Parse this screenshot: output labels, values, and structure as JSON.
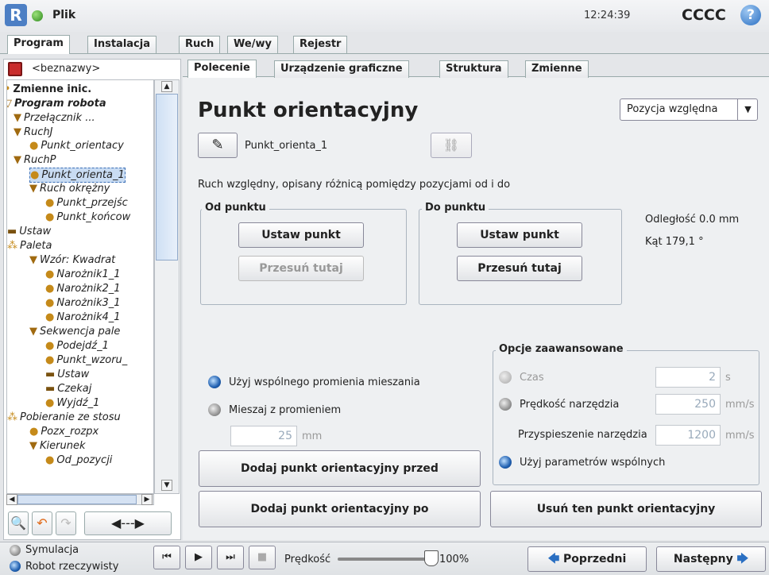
{
  "topbar": {
    "file_label": "Plik",
    "clock": "12:24:39",
    "robot_name": "CCCC",
    "help": "?"
  },
  "main_tabs": [
    "Program",
    "Instalacja",
    "Ruch",
    "We/wy",
    "Rejestr"
  ],
  "sub_tabs": [
    "Polecenie",
    "Urządzenie graficzne",
    "Struktura",
    "Zmienne"
  ],
  "program_name": "<beznazwy>",
  "tree": [
    "Zmienne inic.",
    "Program robota",
    "Przełącznik ...",
    "RuchJ",
    "Punkt_orientacy",
    "RuchP",
    "Punkt_orienta_1",
    "Ruch okrężny",
    "Punkt_przejśc",
    "Punkt_końcow",
    "Ustaw",
    "Paleta",
    "Wzór: Kwadrat",
    "Narożnik1_1",
    "Narożnik2_1",
    "Narożnik3_1",
    "Narożnik4_1",
    "Sekwencja pale",
    "Podejdź_1",
    "Punkt_wzoru_",
    "Ustaw",
    "Czekaj",
    "Wyjdź_1",
    "Pobieranie ze stosu",
    "Pozx_rozpx",
    "Kierunek",
    "Od_pozycji"
  ],
  "main": {
    "title": "Punkt orientacyjny",
    "position_mode": "Pozycja względna",
    "waypoint_name": "Punkt_orienta_1",
    "description": "Ruch względny, opisany różnicą pomiędzy pozycjami od i do",
    "from_label": "Od punktu",
    "to_label": "Do punktu",
    "set_point": "Ustaw punkt",
    "move_here": "Przesuń tutaj",
    "distance": "Odległość 0.0 mm",
    "angle": "Kąt 179,1 °",
    "shared_blend": "Użyj wspólnego promienia mieszania",
    "blend_radius": "Mieszaj z promieniem",
    "blend_value": "25",
    "blend_unit": "mm",
    "advanced_label": "Opcje zaawansowane",
    "time_label": "Czas",
    "time_value": "2",
    "time_unit": "s",
    "tool_speed_label": "Prędkość narzędzia",
    "tool_speed_value": "250",
    "tool_speed_unit": "mm/s",
    "tool_accel_label": "Przyspieszenie narzędzia",
    "tool_accel_value": "1200",
    "tool_accel_unit": "mm/s",
    "shared_params": "Użyj parametrów wspólnych",
    "add_before": "Dodaj punkt orientacyjny przed",
    "add_after": "Dodaj punkt orientacyjny po",
    "remove": "Usuń ten punkt orientacyjny"
  },
  "bottom": {
    "simulation": "Symulacja",
    "real_robot": "Robot rzeczywisty",
    "speed_label": "Prędkość",
    "speed_value": "100%",
    "prev": "Poprzedni",
    "next": "Następny"
  }
}
